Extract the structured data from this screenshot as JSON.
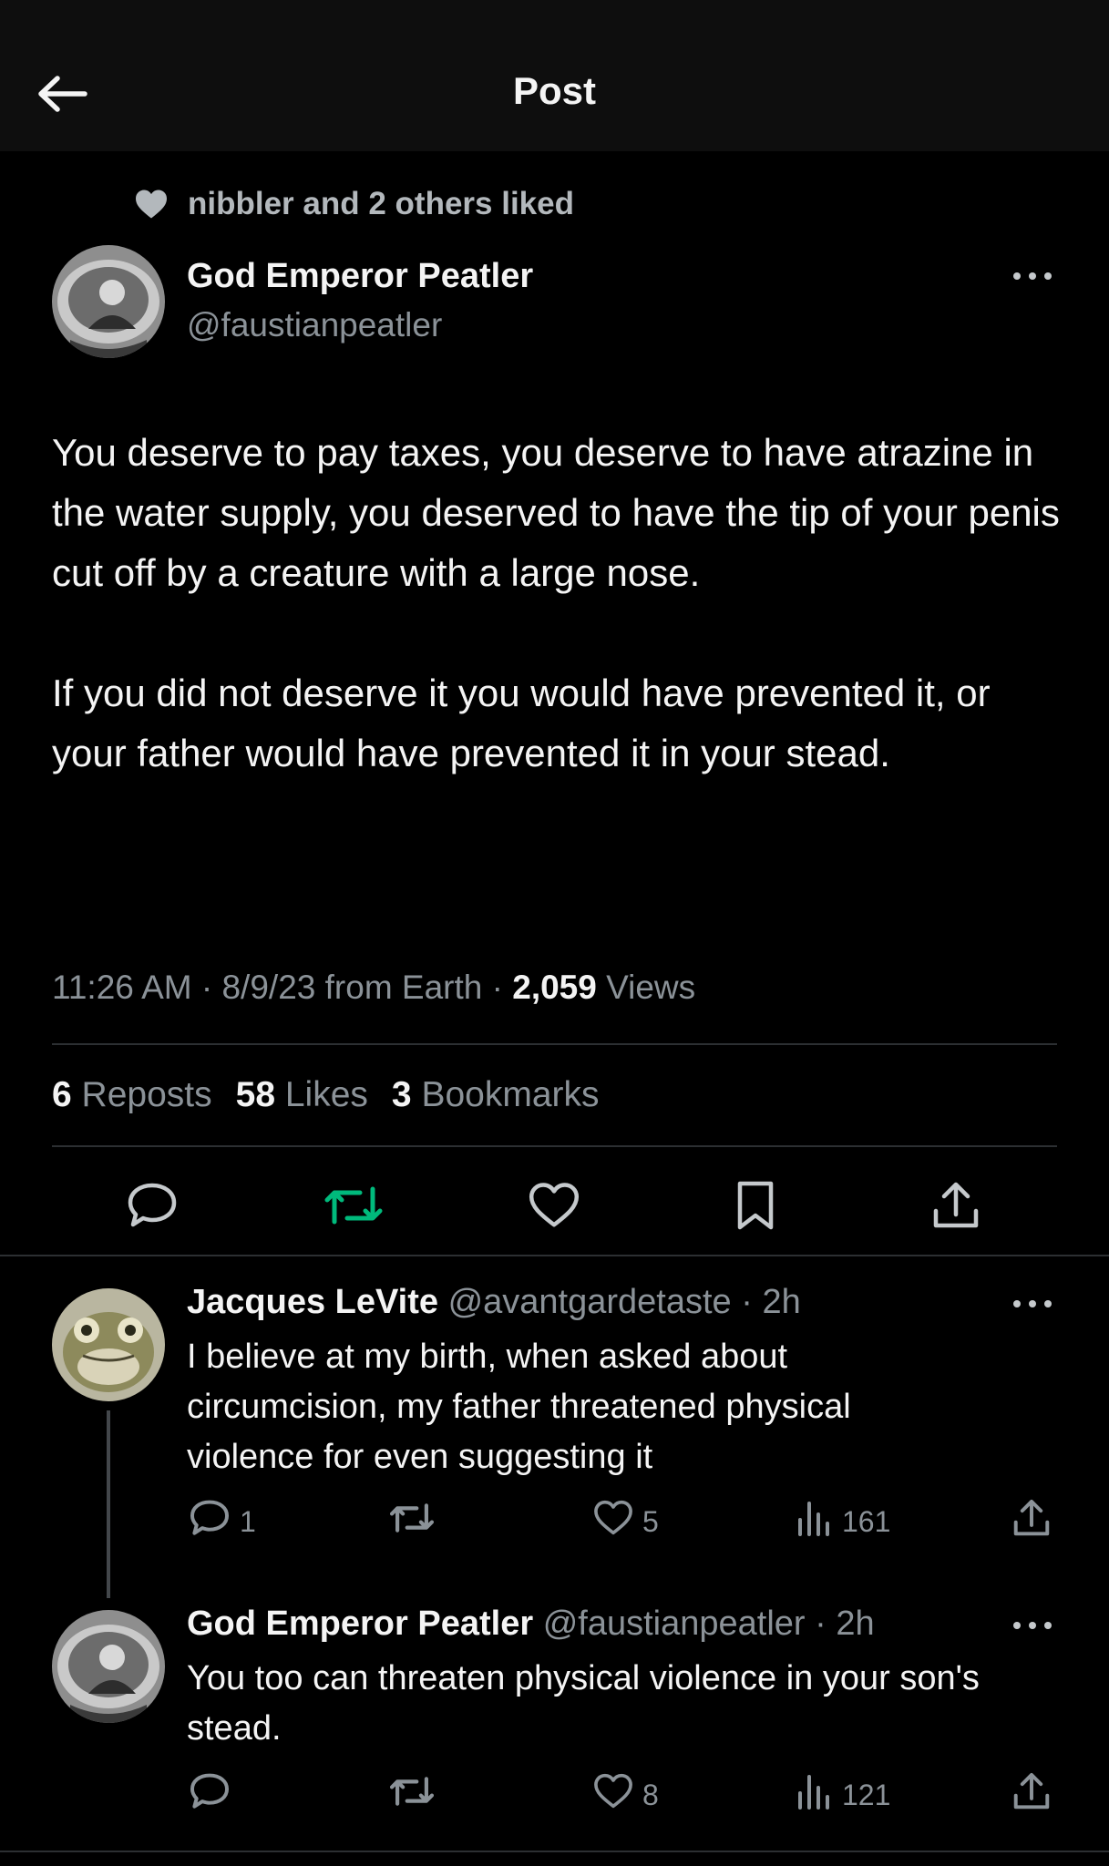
{
  "header": {
    "title": "Post"
  },
  "social_context": "nibbler and 2 others liked",
  "post": {
    "author_name": "God Emperor Peatler",
    "author_handle": "@faustianpeatler",
    "paragraphs": [
      "You deserve to pay taxes, you deserve to have atrazine in the water supply, you deserved to have the tip of your penis cut off by a creature with a large nose.",
      "If you did not deserve it you would have prevented it, or your father would have prevented it in your stead."
    ],
    "time": "11:26 AM",
    "date": "8/9/23",
    "location": "from Earth",
    "views_count": "2,059",
    "views_label": "Views",
    "reposts_count": "6",
    "reposts_label": "Reposts",
    "likes_count": "58",
    "likes_label": "Likes",
    "bookmarks_count": "3",
    "bookmarks_label": "Bookmarks"
  },
  "replies": [
    {
      "name": "Jacques LeVite",
      "handle": "@avantgardetaste",
      "time": "2h",
      "text": "I believe at my birth, when asked about circumcision, my father threatened physical violence for even suggesting it",
      "reply_count": "1",
      "like_count": "5",
      "view_count": "161"
    },
    {
      "name": "God Emperor Peatler",
      "handle": "@faustianpeatler",
      "time": "2h",
      "text": "You too can threaten physical violence in your son's stead.",
      "reply_count": "",
      "like_count": "8",
      "view_count": "121"
    }
  ],
  "colors": {
    "background": "#000000",
    "header_background": "#0e0e0e",
    "text_primary": "#f4f4f4",
    "text_secondary": "#8b9298",
    "divider": "#2c2f32",
    "repost_active": "#00ba7c"
  },
  "icons": {
    "back": "arrow-left-icon",
    "liked_context": "heart-filled-icon",
    "more": "more-horizontal-icon",
    "reply": "comment-bubble-icon",
    "repost": "repost-icon",
    "like": "heart-outline-icon",
    "bookmark": "bookmark-icon",
    "share": "share-upload-icon",
    "views": "analytics-bars-icon"
  }
}
